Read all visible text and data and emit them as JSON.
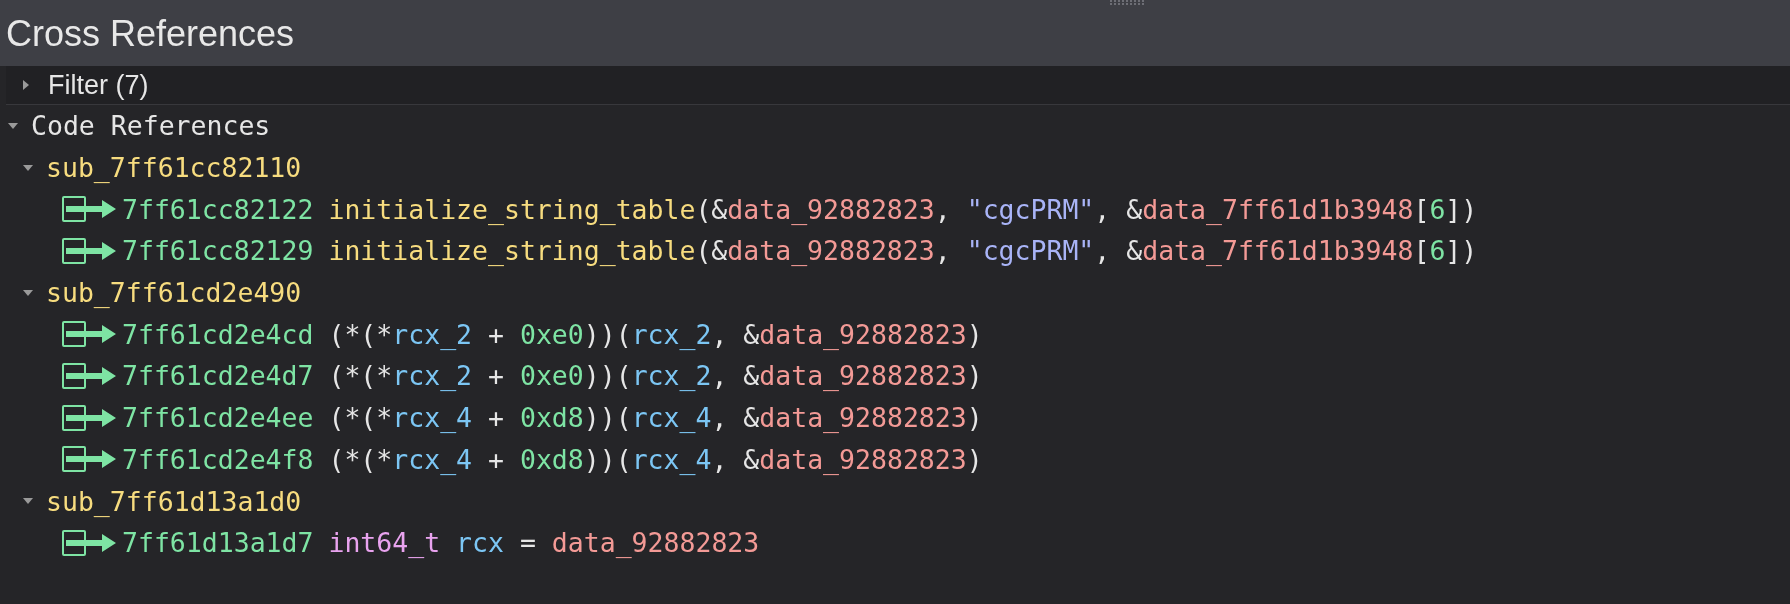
{
  "window": {
    "title": "Cross References"
  },
  "filter": {
    "label": "Filter (7)",
    "expanded": false
  },
  "sections": [
    {
      "label": "Code References",
      "expanded": true,
      "children": [
        {
          "label": "sub_7ff61cc82110",
          "expanded": true,
          "children": [
            {
              "address": "7ff61cc82122",
              "tokens": [
                {
                  "kind": "func",
                  "text": "initialize_string_table"
                },
                {
                  "kind": "plain",
                  "text": "(&"
                },
                {
                  "kind": "data",
                  "text": "data_92882823"
                },
                {
                  "kind": "plain",
                  "text": ", "
                },
                {
                  "kind": "string",
                  "text": "\"cgcPRM\""
                },
                {
                  "kind": "plain",
                  "text": ", &"
                },
                {
                  "kind": "data",
                  "text": "data_7ff61d1b3948"
                },
                {
                  "kind": "plain",
                  "text": "["
                },
                {
                  "kind": "number",
                  "text": "6"
                },
                {
                  "kind": "plain",
                  "text": "])"
                }
              ]
            },
            {
              "address": "7ff61cc82129",
              "tokens": [
                {
                  "kind": "func",
                  "text": "initialize_string_table"
                },
                {
                  "kind": "plain",
                  "text": "(&"
                },
                {
                  "kind": "data",
                  "text": "data_92882823"
                },
                {
                  "kind": "plain",
                  "text": ", "
                },
                {
                  "kind": "string",
                  "text": "\"cgcPRM\""
                },
                {
                  "kind": "plain",
                  "text": ", &"
                },
                {
                  "kind": "data",
                  "text": "data_7ff61d1b3948"
                },
                {
                  "kind": "plain",
                  "text": "["
                },
                {
                  "kind": "number",
                  "text": "6"
                },
                {
                  "kind": "plain",
                  "text": "])"
                }
              ]
            }
          ]
        },
        {
          "label": "sub_7ff61cd2e490",
          "expanded": true,
          "children": [
            {
              "address": "7ff61cd2e4cd",
              "tokens": [
                {
                  "kind": "plain",
                  "text": "(*(*"
                },
                {
                  "kind": "var",
                  "text": "rcx_2"
                },
                {
                  "kind": "plain",
                  "text": " + "
                },
                {
                  "kind": "number",
                  "text": "0xe0"
                },
                {
                  "kind": "plain",
                  "text": "))("
                },
                {
                  "kind": "var",
                  "text": "rcx_2"
                },
                {
                  "kind": "plain",
                  "text": ", &"
                },
                {
                  "kind": "data",
                  "text": "data_92882823"
                },
                {
                  "kind": "plain",
                  "text": ")"
                }
              ]
            },
            {
              "address": "7ff61cd2e4d7",
              "tokens": [
                {
                  "kind": "plain",
                  "text": "(*(*"
                },
                {
                  "kind": "var",
                  "text": "rcx_2"
                },
                {
                  "kind": "plain",
                  "text": " + "
                },
                {
                  "kind": "number",
                  "text": "0xe0"
                },
                {
                  "kind": "plain",
                  "text": "))("
                },
                {
                  "kind": "var",
                  "text": "rcx_2"
                },
                {
                  "kind": "plain",
                  "text": ", &"
                },
                {
                  "kind": "data",
                  "text": "data_92882823"
                },
                {
                  "kind": "plain",
                  "text": ")"
                }
              ]
            },
            {
              "address": "7ff61cd2e4ee",
              "tokens": [
                {
                  "kind": "plain",
                  "text": "(*(*"
                },
                {
                  "kind": "var",
                  "text": "rcx_4"
                },
                {
                  "kind": "plain",
                  "text": " + "
                },
                {
                  "kind": "number",
                  "text": "0xd8"
                },
                {
                  "kind": "plain",
                  "text": "))("
                },
                {
                  "kind": "var",
                  "text": "rcx_4"
                },
                {
                  "kind": "plain",
                  "text": ", &"
                },
                {
                  "kind": "data",
                  "text": "data_92882823"
                },
                {
                  "kind": "plain",
                  "text": ")"
                }
              ]
            },
            {
              "address": "7ff61cd2e4f8",
              "tokens": [
                {
                  "kind": "plain",
                  "text": "(*(*"
                },
                {
                  "kind": "var",
                  "text": "rcx_4"
                },
                {
                  "kind": "plain",
                  "text": " + "
                },
                {
                  "kind": "number",
                  "text": "0xd8"
                },
                {
                  "kind": "plain",
                  "text": "))("
                },
                {
                  "kind": "var",
                  "text": "rcx_4"
                },
                {
                  "kind": "plain",
                  "text": ", &"
                },
                {
                  "kind": "data",
                  "text": "data_92882823"
                },
                {
                  "kind": "plain",
                  "text": ")"
                }
              ]
            }
          ]
        },
        {
          "label": "sub_7ff61d13a1d0",
          "expanded": true,
          "children": [
            {
              "address": "7ff61d13a1d7",
              "tokens": [
                {
                  "kind": "type",
                  "text": "int64_t "
                },
                {
                  "kind": "var",
                  "text": "rcx"
                },
                {
                  "kind": "plain",
                  "text": " = "
                },
                {
                  "kind": "data",
                  "text": "data_92882823"
                }
              ]
            }
          ]
        }
      ]
    }
  ]
}
